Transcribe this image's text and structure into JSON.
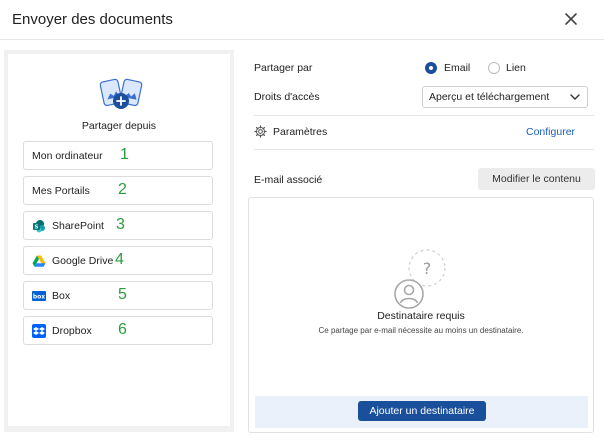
{
  "dialog": {
    "title": "Envoyer des documents",
    "close_icon": "close-icon"
  },
  "left": {
    "heading": "Partager depuis",
    "heading_icon": "share-documents-icon",
    "sources": [
      {
        "label": "Mon ordinateur",
        "number": "1",
        "icon": ""
      },
      {
        "label": "Mes Portails",
        "number": "2",
        "icon": ""
      },
      {
        "label": "SharePoint",
        "number": "3",
        "icon": "sharepoint-icon"
      },
      {
        "label": "Google Drive",
        "number": "4",
        "icon": "google-drive-icon"
      },
      {
        "label": "Box",
        "number": "5",
        "icon": "box-icon"
      },
      {
        "label": "Dropbox",
        "number": "6",
        "icon": "dropbox-icon"
      }
    ]
  },
  "right": {
    "share_by_label": "Partager par",
    "share_by_options": [
      {
        "label": "Email",
        "selected": true
      },
      {
        "label": "Lien",
        "selected": false
      }
    ],
    "access_label": "Droits d'accès",
    "access_value": "Aperçu et téléchargement",
    "settings_label": "Paramètres",
    "settings_link": "Configurer",
    "email_label": "E-mail associé",
    "edit_content_button": "Modifier le contenu",
    "recipient": {
      "title": "Destinataire requis",
      "subtitle": "Ce partage par e-mail nécessite au moins un destinataire.",
      "add_button": "Ajouter un destinataire"
    }
  },
  "colors": {
    "accent": "#1a4f9c",
    "link": "#1a5fb4",
    "number": "#2a9d3c",
    "footer_bg": "#eaf1fb"
  }
}
